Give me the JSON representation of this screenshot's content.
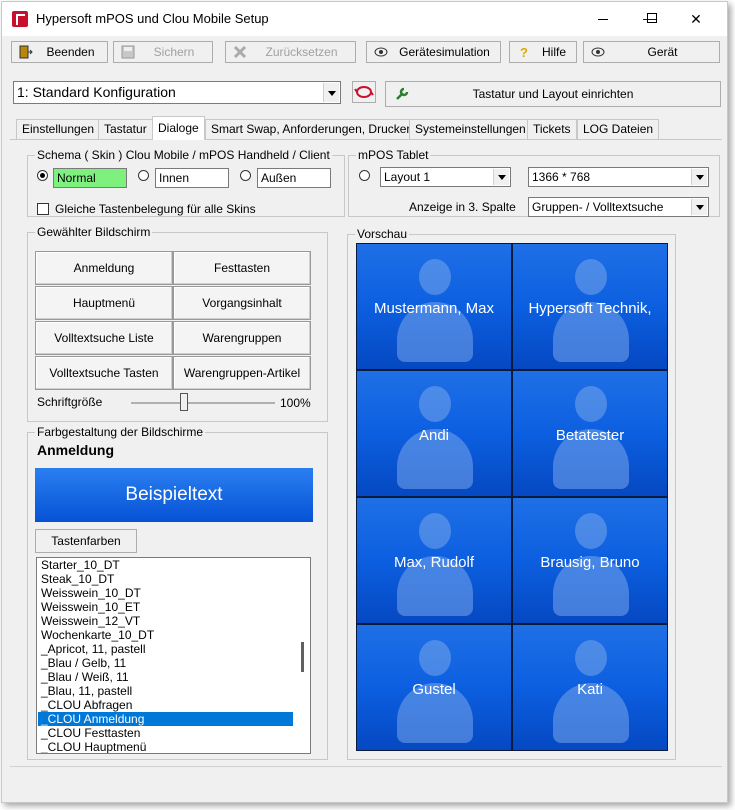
{
  "window": {
    "title": "Hypersoft mPOS und Clou Mobile Setup"
  },
  "toolbar": {
    "beenden": "Beenden",
    "sichern": "Sichern",
    "zuruecksetzen": "Zurücksetzen",
    "simulation": "Gerätesimulation",
    "hilfe": "Hilfe",
    "geraet": "Gerät"
  },
  "config": {
    "selected": "1: Standard Konfiguration",
    "layout_button": "Tastatur und Layout einrichten"
  },
  "tabs": [
    {
      "label": "Einstellungen",
      "active": false
    },
    {
      "label": "Tastatur",
      "active": false
    },
    {
      "label": "Dialoge",
      "active": true
    },
    {
      "label": "Smart Swap, Anforderungen, Drucker",
      "active": false
    },
    {
      "label": "Systemeinstellungen",
      "active": false
    },
    {
      "label": "Tickets",
      "active": false
    },
    {
      "label": "LOG Dateien",
      "active": false
    }
  ],
  "schema": {
    "label": "Schema ( Skin ) Clou Mobile / mPOS Handheld / Client",
    "normal": "Normal",
    "innen": "Innen",
    "aussen": "Außen",
    "selected": "Normal",
    "same_keys_label": "Gleiche Tastenbelegung für alle Skins",
    "same_keys_checked": false
  },
  "tablet": {
    "label": "mPOS Tablet",
    "layout": "Layout 1",
    "resolution": "1366 * 768",
    "col3_label": "Anzeige in 3. Spalte",
    "col3_value": "Gruppen- / Volltextsuche"
  },
  "screens": {
    "label": "Gewählter Bildschirm",
    "buttons": [
      "Anmeldung",
      "Festtasten",
      "Hauptmenü",
      "Vorgangsinhalt",
      "Volltextsuche Liste",
      "Warengruppen",
      "Volltextsuche Tasten",
      "Warengruppen-Artikel"
    ],
    "font_label": "Schriftgröße",
    "font_value": "100%",
    "font_level_percent": 100
  },
  "colors": {
    "label": "Farbgestaltung der Bildschirme",
    "screen_name": "Anmeldung",
    "sample_text": "Beispieltext",
    "tastenfarben": "Tastenfarben",
    "accent": "#0a5fe0",
    "selection": "#0078d7",
    "list_items": [
      "Starter_10_DT",
      "Steak_10_DT",
      "Weisswein_10_DT",
      "Weisswein_10_ET",
      "Weisswein_12_VT",
      "Wochenkarte_10_DT",
      "_Apricot, 11, pastell",
      "_Blau / Gelb, 11",
      "_Blau / Weiß, 11",
      "_Blau, 11, pastell",
      "_CLOU Abfragen",
      "_CLOU Anmeldung",
      "_CLOU Festtasten",
      "_CLOU Hauptmenü"
    ],
    "selected_item": "_CLOU Anmeldung"
  },
  "preview": {
    "label": "Vorschau",
    "users": [
      "Mustermann, Max",
      "Hypersoft Technik,",
      "Andi",
      "Betatester",
      "Max, Rudolf",
      "Brausig, Bruno",
      "Gustel",
      "Kati"
    ]
  }
}
